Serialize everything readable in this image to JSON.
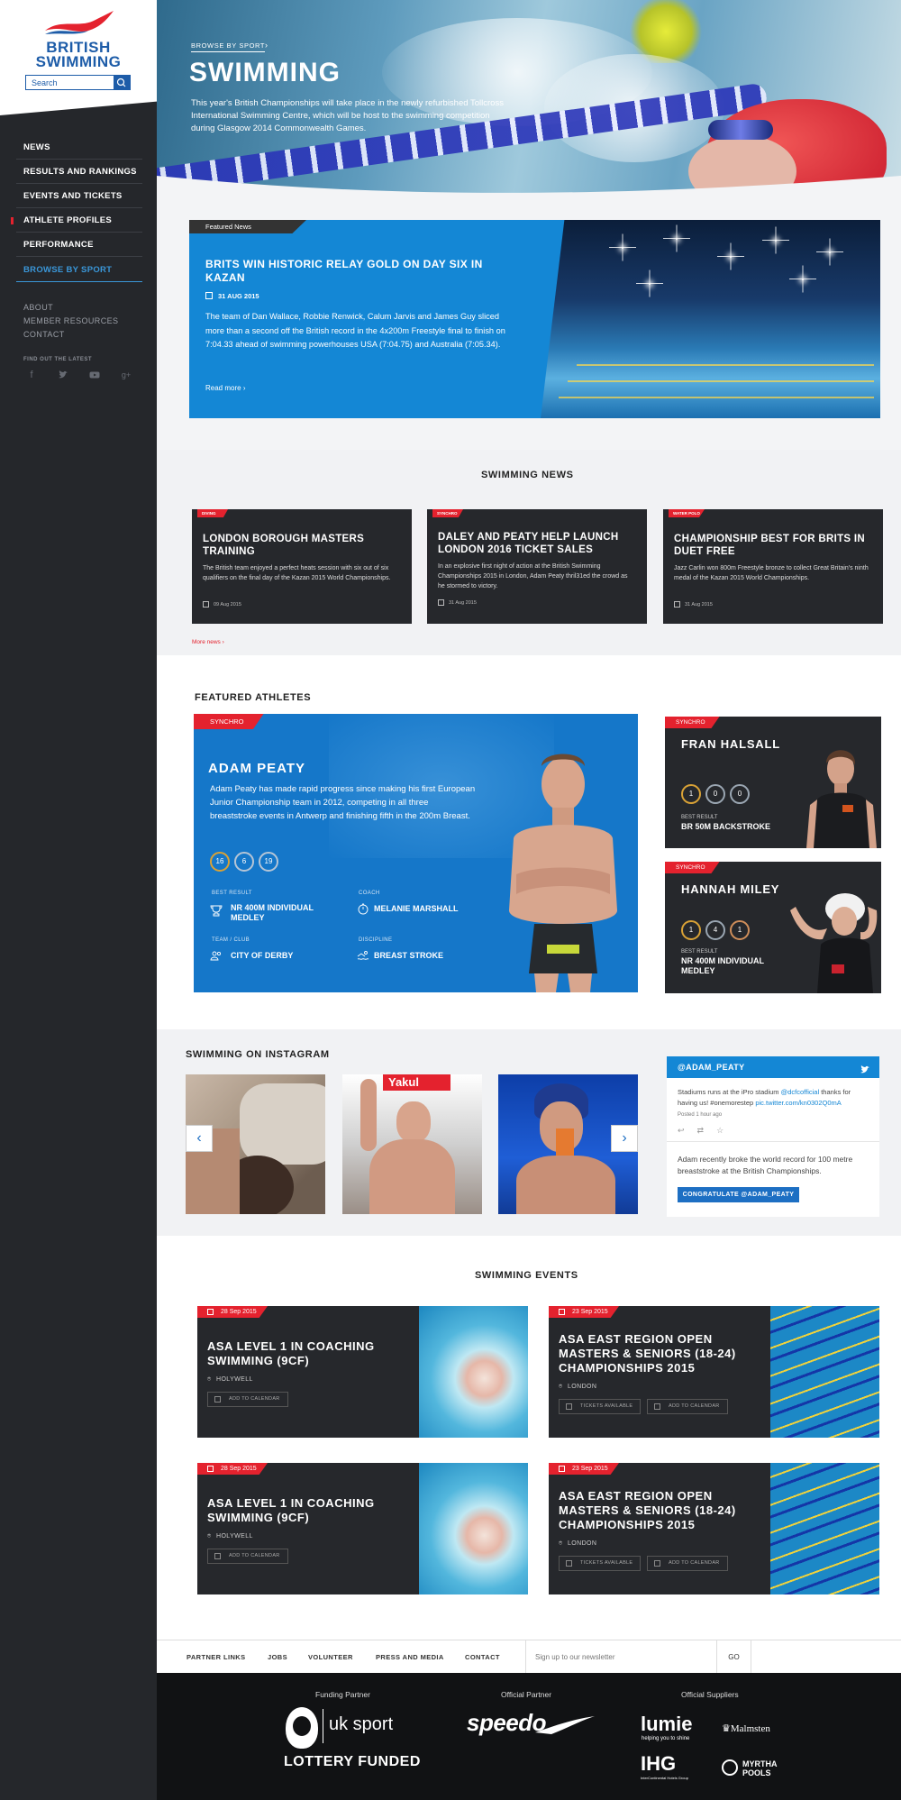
{
  "brand": {
    "name_line1": "BRITISH",
    "name_line2": "SWIMMING",
    "colors": {
      "primary_blue": "#1d5ca8",
      "accent_red": "#e4222e",
      "sky_blue": "#1487d5",
      "dark": "#26282c"
    }
  },
  "search": {
    "placeholder": "Search",
    "icon": "search-icon"
  },
  "nav": {
    "items": [
      {
        "label": "NEWS"
      },
      {
        "label": "RESULTS AND RANKINGS"
      },
      {
        "label": "EVENTS AND TICKETS"
      },
      {
        "label": "ATHLETE PROFILES"
      },
      {
        "label": "PERFORMANCE"
      },
      {
        "label": "BROWSE BY SPORT"
      }
    ],
    "secondary": [
      "ABOUT",
      "MEMBER RESOURCES",
      "CONTACT"
    ],
    "find_out_label": "FIND OUT THE LATEST",
    "social_icons": [
      "facebook-icon",
      "twitter-icon",
      "youtube-icon",
      "google-plus-icon"
    ]
  },
  "hero": {
    "breadcrumb": "BROWSE BY SPORT",
    "title": "SWIMMING",
    "description": "This year's British Championships will take place in the newly refurbished Tollcross International Swimming Centre, which will be host to the swimming competition during Glasgow 2014 Commonwealth Games."
  },
  "featured_news": {
    "tag": "Featured News",
    "title": "BRITS WIN HISTORIC RELAY GOLD ON DAY SIX IN KAZAN",
    "date": "31 AUG 2015",
    "body": "The team of Dan Wallace, Robbie Renwick, Calum Jarvis and James Guy sliced more than a second off the British record in the 4x200m Freestyle final to finish on 7:04.33 ahead of swimming powerhouses USA (7:04.75) and Australia (7:05.34).",
    "read_more": "Read more"
  },
  "swimming_news": {
    "title": "SWIMMING NEWS",
    "more": "More news",
    "cards": [
      {
        "tag": "DIVING",
        "title": "LONDON BOROUGH MASTERS TRAINING",
        "body": "The British team enjoyed a perfect heats session with six out of six qualifiers on the final day of the Kazan 2015 World Championships.",
        "date": "09 Aug 2015"
      },
      {
        "tag": "SYNCHRO",
        "title": "DALEY AND PEATY HELP LAUNCH LONDON 2016 TICKET SALES",
        "body": "In an explosive first night of action at the British Swimming Championships 2015 in London, Adam Peaty thril31ed the crowd as he stormed to victory.",
        "date": "31 Aug 2015"
      },
      {
        "tag": "WATER POLO",
        "title": "CHAMPIONSHIP BEST FOR BRITS IN DUET FREE",
        "body": "Jazz Carlin won 800m Freestyle bronze to collect Great Britain's ninth medal of the Kazan 2015 World Championships.",
        "date": "31 Aug 2015"
      }
    ]
  },
  "featured_athletes": {
    "title": "FEATURED ATHLETES",
    "main": {
      "tag": "SYNCHRO",
      "name": "ADAM PEATY",
      "bio": "Adam Peaty has made rapid progress since making his first European Junior Championship team in 2012, competing in all three breaststroke events in Antwerp and finishing fifth in the 200m Breast.",
      "medals": [
        "16",
        "6",
        "19"
      ],
      "best_result_label": "BEST RESULT",
      "best_result": "NR 400M INDIVIDUAL MEDLEY",
      "coach_label": "COACH",
      "coach": "MELANIE MARSHALL",
      "club_label": "TEAM / CLUB",
      "club": "CITY OF DERBY",
      "discipline_label": "DISCIPLINE",
      "discipline": "BREAST STROKE"
    },
    "side": [
      {
        "tag": "SYNCHRO",
        "name": "FRAN HALSALL",
        "medals": [
          "1",
          "0",
          "0"
        ],
        "best_label": "BEST RESULT",
        "best": "BR 50M BACKSTROKE"
      },
      {
        "tag": "SYNCHRO",
        "name": "HANNAH MILEY",
        "medals": [
          "1",
          "4",
          "1"
        ],
        "best_label": "BEST RESULT",
        "best": "NR 400M INDIVIDUAL MEDLEY"
      }
    ]
  },
  "instagram": {
    "title": "SWIMMING ON INSTAGRAM",
    "prev": "‹",
    "next": "›",
    "poster_text": "Yakul"
  },
  "twitter": {
    "handle": "@ADAM_PEATY",
    "tweet_pre": "Stadiums runs at the iPro stadium ",
    "tweet_mention": "@dcfcofficial",
    "tweet_mid": " thanks for having us! #onemorestep ",
    "tweet_link": "pic.twitter.com/kn0302Q0mA",
    "posted": "Posted 1 hour ago",
    "body": "Adam recently broke the world record for 100 metre breaststroke at the British Championships.",
    "button": "CONGRATULATE @ADAM_PEATY"
  },
  "events": {
    "title": "SWIMMING EVENTS",
    "cards": [
      {
        "date": "28 Sep 2015",
        "title": "ASA LEVEL 1 IN COACHING SWIMMING (9CF)",
        "location": "HOLYWELL",
        "buttons": [
          "ADD TO CALENDAR"
        ]
      },
      {
        "date": "23 Sep 2015",
        "title": "ASA EAST REGION OPEN MASTERS & SENIORS (18-24) CHAMPIONSHIPS 2015",
        "location": "LONDON",
        "buttons": [
          "TICKETS AVAILABLE",
          "ADD TO CALENDAR"
        ]
      },
      {
        "date": "28 Sep 2015",
        "title": "ASA LEVEL 1 IN COACHING SWIMMING (9CF)",
        "location": "HOLYWELL",
        "buttons": [
          "ADD TO CALENDAR"
        ]
      },
      {
        "date": "23 Sep 2015",
        "title": "ASA EAST REGION OPEN MASTERS & SENIORS (18-24) CHAMPIONSHIPS 2015",
        "location": "LONDON",
        "buttons": [
          "TICKETS AVAILABLE",
          "ADD TO CALENDAR"
        ]
      }
    ]
  },
  "footer": {
    "links": [
      "PARTNER LINKS",
      "JOBS",
      "VOLUNTEER",
      "PRESS AND MEDIA",
      "CONTACT"
    ],
    "newsletter_placeholder": "Sign up to our newsletter",
    "go": "GO"
  },
  "partners": {
    "funding_label": "Funding Partner",
    "official_label": "Official Partner",
    "suppliers_label": "Official Suppliers",
    "uk_sport": "uk sport",
    "lottery": "LOTTERY FUNDED",
    "speedo": "speedo",
    "lumie": "lumie",
    "lumie_tag": "helping you to shine",
    "malmsten": "Malmsten",
    "ihg": "IHG",
    "ihg_tag": "InterContinental Hotels Group",
    "myrtha_1": "MYRTHA",
    "myrtha_2": "POOLS"
  }
}
